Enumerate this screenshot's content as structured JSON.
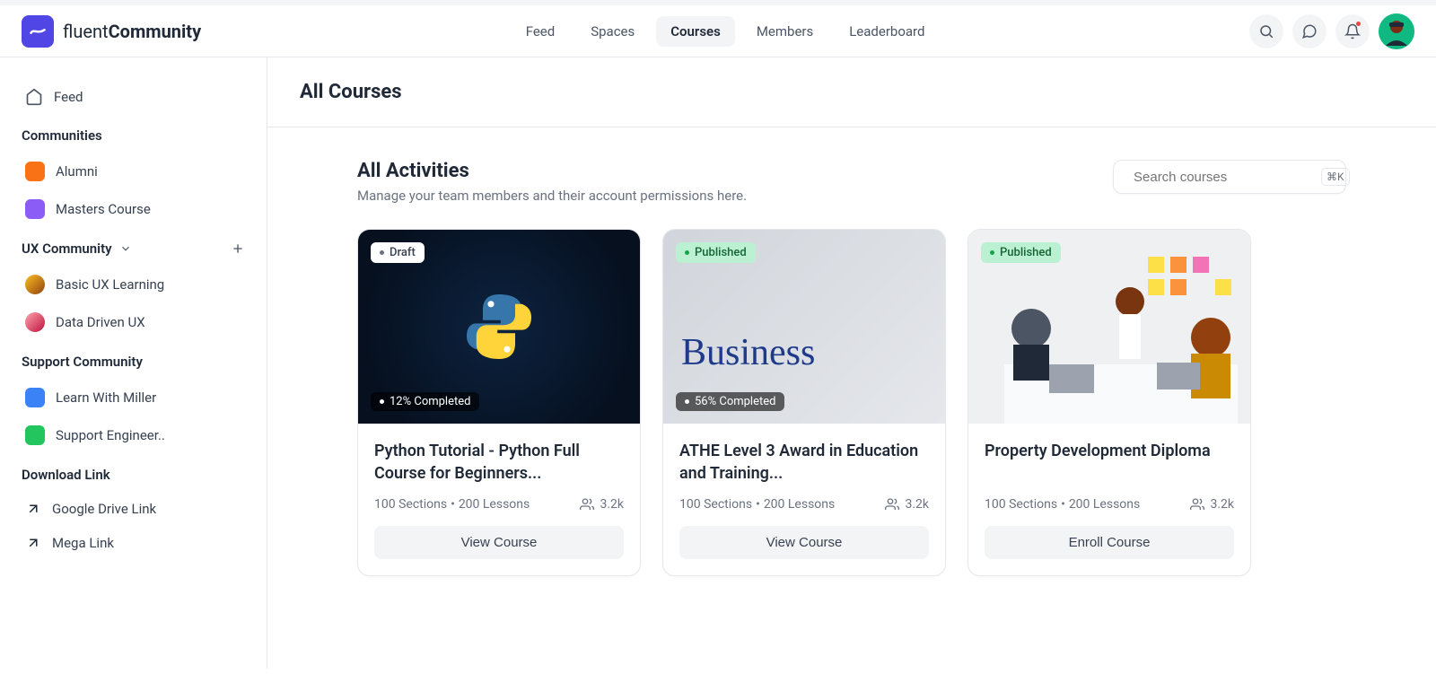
{
  "brand": {
    "name_light": "fluent",
    "name_bold": "Community"
  },
  "nav": {
    "items": [
      {
        "label": "Feed"
      },
      {
        "label": "Spaces"
      },
      {
        "label": "Courses"
      },
      {
        "label": "Members"
      },
      {
        "label": "Leaderboard"
      }
    ]
  },
  "sidebar": {
    "feed": "Feed",
    "sections": {
      "communities": {
        "title": "Communities",
        "items": [
          {
            "label": "Alumni",
            "color": "#f97316"
          },
          {
            "label": "Masters Course",
            "color": "#8b5cf6"
          }
        ]
      },
      "ux": {
        "title": "UX Community",
        "items": [
          {
            "label": "Basic UX Learning"
          },
          {
            "label": "Data Driven UX"
          }
        ]
      },
      "support": {
        "title": "Support Community",
        "items": [
          {
            "label": "Learn With Miller",
            "color": "#3b82f6"
          },
          {
            "label": "Support Engineer..",
            "color": "#22c55e"
          }
        ]
      },
      "download": {
        "title": "Download Link",
        "items": [
          {
            "label": "Google Drive Link"
          },
          {
            "label": "Mega Link"
          }
        ]
      }
    }
  },
  "page": {
    "title": "All Courses",
    "section_title": "All Activities",
    "section_subtitle": "Manage your team members and their account permissions here."
  },
  "search": {
    "placeholder": "Search courses",
    "shortcut": "⌘K"
  },
  "courses": [
    {
      "status": "Draft",
      "status_type": "draft",
      "progress": "12% Completed",
      "title": "Python Tutorial - Python Full Course for Beginners...",
      "sections": "100 Sections",
      "lessons": "200 Lessons",
      "members": "3.2k",
      "button": "View Course"
    },
    {
      "status": "Published",
      "status_type": "published",
      "progress": "56% Completed",
      "title": "ATHE Level 3 Award in Education and Training...",
      "sections": "100 Sections",
      "lessons": "200 Lessons",
      "members": "3.2k",
      "button": "View Course"
    },
    {
      "status": "Published",
      "status_type": "published",
      "progress": "",
      "title": "Property Development Diploma",
      "sections": "100 Sections",
      "lessons": "200 Lessons",
      "members": "3.2k",
      "button": "Enroll Course"
    }
  ]
}
